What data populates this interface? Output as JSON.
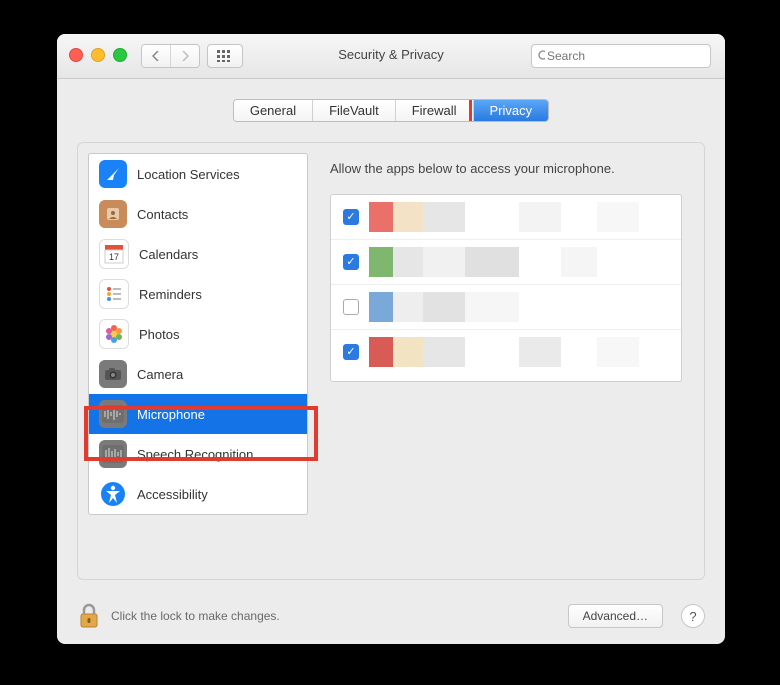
{
  "window": {
    "title": "Security & Privacy"
  },
  "search": {
    "placeholder": "Search"
  },
  "tabs": [
    {
      "label": "General",
      "selected": false
    },
    {
      "label": "FileVault",
      "selected": false
    },
    {
      "label": "Firewall",
      "selected": false
    },
    {
      "label": "Privacy",
      "selected": true,
      "highlighted": true
    }
  ],
  "sidebar": {
    "items": [
      {
        "label": "Location Services",
        "icon": "location-icon"
      },
      {
        "label": "Contacts",
        "icon": "contacts-icon"
      },
      {
        "label": "Calendars",
        "icon": "calendar-icon"
      },
      {
        "label": "Reminders",
        "icon": "reminders-icon"
      },
      {
        "label": "Photos",
        "icon": "photos-icon"
      },
      {
        "label": "Camera",
        "icon": "camera-icon"
      },
      {
        "label": "Microphone",
        "icon": "microphone-icon",
        "selected": true,
        "highlighted": true
      },
      {
        "label": "Speech Recognition",
        "icon": "speech-icon"
      },
      {
        "label": "Accessibility",
        "icon": "accessibility-icon"
      }
    ]
  },
  "main": {
    "description": "Allow the apps below to access your microphone.",
    "apps": [
      {
        "checked": true,
        "colors": [
          "#e97169",
          "#f4e2c6",
          "#e6e6e6",
          "#fff",
          "#f3f3f3",
          "#fff",
          "#f7f7f7",
          "#fff"
        ]
      },
      {
        "checked": true,
        "colors": [
          "#7fb76f",
          "#e6e6e6",
          "#f1f1f1",
          "#e0e0e0",
          "#fff",
          "#f5f5f5",
          "#fff",
          "#fff"
        ]
      },
      {
        "checked": false,
        "colors": [
          "#7aa8d8",
          "#eeeeee",
          "#e2e2e2",
          "#f6f6f6",
          "#fff",
          "#fff",
          "#fff",
          "#fff"
        ]
      },
      {
        "checked": true,
        "colors": [
          "#d95b55",
          "#f2e4c2",
          "#e6e6e6",
          "#fff",
          "#eaeaea",
          "#fff",
          "#f7f7f7",
          "#fff"
        ]
      }
    ]
  },
  "footer": {
    "lock_text": "Click the lock to make changes.",
    "advanced_label": "Advanced…"
  }
}
